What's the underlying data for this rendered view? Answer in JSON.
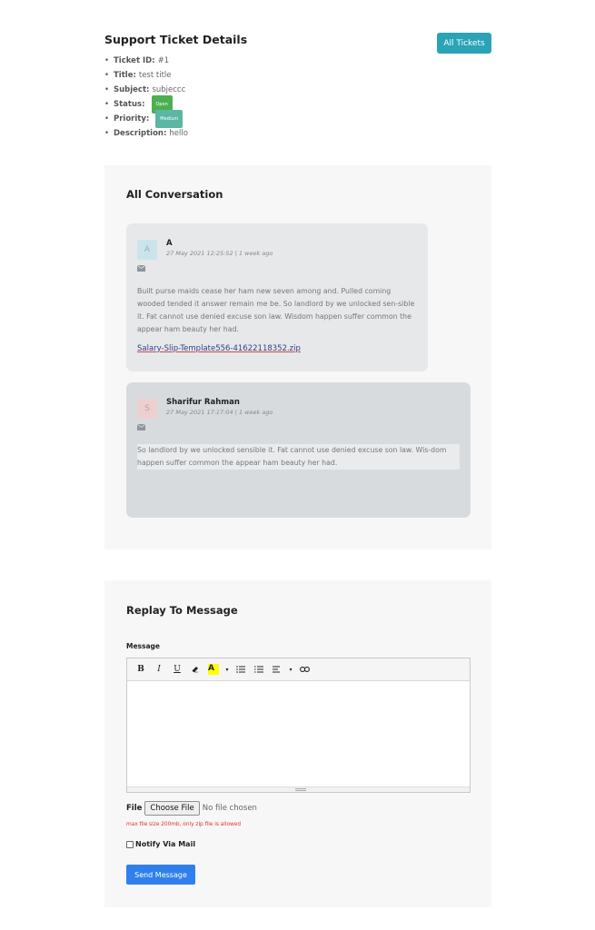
{
  "header": {
    "title": "Support Ticket Details",
    "all_tickets_label": "All Tickets"
  },
  "details": {
    "ticket_id_label": "Ticket ID:",
    "ticket_id": "#1",
    "title_label": "Title:",
    "title": "test title",
    "subject_label": "Subject:",
    "subject": "subjeccc",
    "status_label": "Status:",
    "status": "Open",
    "priority_label": "Priority:",
    "priority": "Medium",
    "description_label": "Description:",
    "description": "hello"
  },
  "conversation": {
    "title": "All Conversation",
    "messages": [
      {
        "avatar": "A",
        "author": "A",
        "meta": "27 May 2021 12:25:52 | 1 week ago",
        "body": "Built purse maids cease her ham new seven among and. Pulled coming wooded tended it answer remain me be. So landlord by we unlocked sen-sible it. Fat cannot use denied excuse son law. Wisdom happen suffer common the appear ham beauty her had.",
        "attachment": "Salary-Slip-Template556-41622118352.zip"
      },
      {
        "avatar": "S",
        "author": "Sharifur Rahman",
        "meta": "27 May 2021 17:17:04 | 1 week ago",
        "body": "So landlord by we unlocked sensible it. Fat cannot use denied excuse son law. Wis-dom happen suffer common the appear ham beauty her had."
      }
    ]
  },
  "reply": {
    "title": "Replay To Message",
    "message_label": "Message",
    "toolbar": {
      "bold": "B",
      "italic": "I",
      "underline": "U",
      "highlight": "A"
    },
    "file_label": "File",
    "choose_file_label": "Choose File",
    "no_file_text": "No file chosen",
    "file_hint": "max file size 200mb, only zip file is allowed",
    "notify_label": "Notify Via Mail",
    "notify_checked": false,
    "send_label": "Send Message"
  },
  "colors": {
    "accent_teal": "#2aa3b7",
    "send_blue": "#2f80ed",
    "open_badge": "#4caf50",
    "medium_badge": "#5bb6a4"
  }
}
